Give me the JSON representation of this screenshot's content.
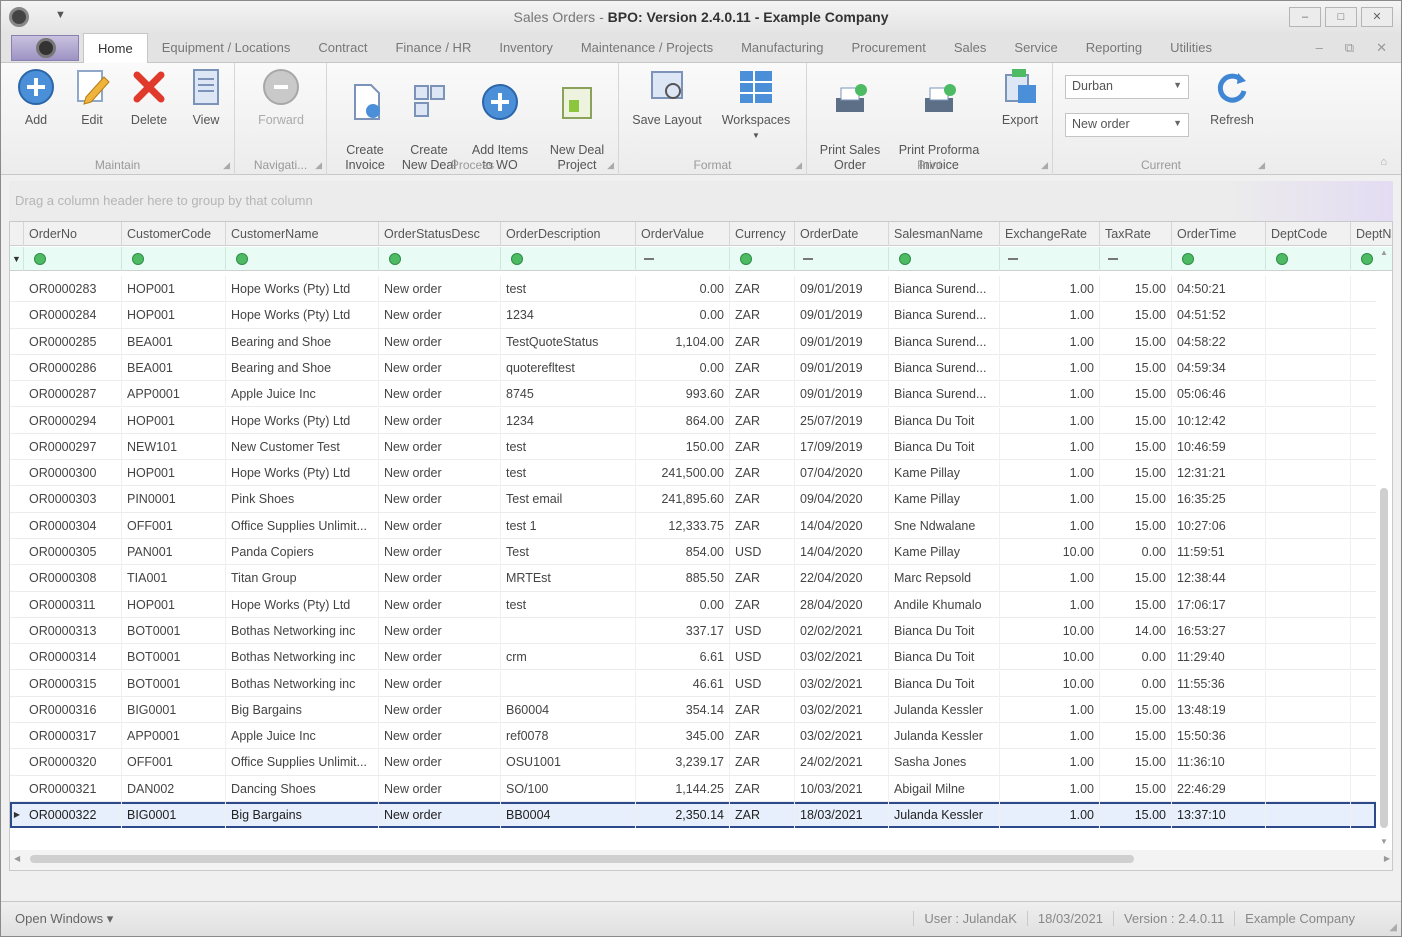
{
  "window": {
    "title_prefix": "Sales Orders - ",
    "title_bold": "BPO: Version 2.4.0.11 - Example Company",
    "controls": [
      "–",
      "□",
      "✕"
    ]
  },
  "tabs": [
    "Home",
    "Equipment / Locations",
    "Contract",
    "Finance / HR",
    "Inventory",
    "Maintenance / Projects",
    "Manufacturing",
    "Procurement",
    "Sales",
    "Service",
    "Reporting",
    "Utilities"
  ],
  "tab_controls": [
    "–",
    "⧉",
    "✕"
  ],
  "ribbon": {
    "maintain": {
      "title": "Maintain",
      "add": "Add",
      "edit": "Edit",
      "delete": "Delete",
      "view": "View"
    },
    "navigate": {
      "title": "Navigati...",
      "forward": "Forward"
    },
    "process": {
      "title": "Process",
      "create_invoice": "Create\nInvoice",
      "create_new_deal": "Create\nNew Deal",
      "add_items_to_wo": "Add Items\nto WO",
      "new_deal_project": "New Deal\nProject"
    },
    "format": {
      "title": "Format",
      "save_layout": "Save Layout",
      "workspaces": "Workspaces"
    },
    "print": {
      "title": "Print",
      "print_sales_order": "Print Sales\nOrder",
      "print_proforma_invoice": "Print Proforma\nInvoice",
      "export": "Export"
    },
    "current": {
      "title": "Current",
      "branch": "Durban",
      "status": "New order",
      "refresh": "Refresh"
    }
  },
  "group_panel_hint": "Drag a column header here to group by that column",
  "grid": {
    "columns": [
      "OrderNo",
      "CustomerCode",
      "CustomerName",
      "OrderStatusDesc",
      "OrderDescription",
      "OrderValue",
      "Currency",
      "OrderDate",
      "SalesmanName",
      "ExchangeRate",
      "TaxRate",
      "OrderTime",
      "DeptCode",
      "DeptNa"
    ],
    "rows": [
      [
        "OR0000283",
        "HOP001",
        "Hope Works (Pty) Ltd",
        "New order",
        "test",
        "0.00",
        "ZAR",
        "09/01/2019",
        "Bianca Surend...",
        "1.00",
        "15.00",
        "04:50:21",
        "",
        ""
      ],
      [
        "OR0000284",
        "HOP001",
        "Hope Works (Pty) Ltd",
        "New order",
        "1234",
        "0.00",
        "ZAR",
        "09/01/2019",
        "Bianca Surend...",
        "1.00",
        "15.00",
        "04:51:52",
        "",
        ""
      ],
      [
        "OR0000285",
        "BEA001",
        "Bearing and Shoe",
        "New order",
        "TestQuoteStatus",
        "1,104.00",
        "ZAR",
        "09/01/2019",
        "Bianca Surend...",
        "1.00",
        "15.00",
        "04:58:22",
        "",
        ""
      ],
      [
        "OR0000286",
        "BEA001",
        "Bearing and Shoe",
        "New order",
        "quoterefltest",
        "0.00",
        "ZAR",
        "09/01/2019",
        "Bianca Surend...",
        "1.00",
        "15.00",
        "04:59:34",
        "",
        ""
      ],
      [
        "OR0000287",
        "APP0001",
        "Apple Juice Inc",
        "New order",
        "8745",
        "993.60",
        "ZAR",
        "09/01/2019",
        "Bianca Surend...",
        "1.00",
        "15.00",
        "05:06:46",
        "",
        ""
      ],
      [
        "OR0000294",
        "HOP001",
        "Hope Works (Pty) Ltd",
        "New order",
        "1234",
        "864.00",
        "ZAR",
        "25/07/2019",
        "Bianca Du Toit",
        "1.00",
        "15.00",
        "10:12:42",
        "",
        ""
      ],
      [
        "OR0000297",
        "NEW101",
        "New Customer Test",
        "New order",
        "test",
        "150.00",
        "ZAR",
        "17/09/2019",
        "Bianca Du Toit",
        "1.00",
        "15.00",
        "10:46:59",
        "",
        ""
      ],
      [
        "OR0000300",
        "HOP001",
        "Hope Works (Pty) Ltd",
        "New order",
        "test",
        "241,500.00",
        "ZAR",
        "07/04/2020",
        "Kame Pillay",
        "1.00",
        "15.00",
        "12:31:21",
        "",
        ""
      ],
      [
        "OR0000303",
        "PIN0001",
        "Pink Shoes",
        "New order",
        "Test email",
        "241,895.60",
        "ZAR",
        "09/04/2020",
        "Kame Pillay",
        "1.00",
        "15.00",
        "16:35:25",
        "",
        ""
      ],
      [
        "OR0000304",
        "OFF001",
        "Office Supplies Unlimit...",
        "New order",
        "test 1",
        "12,333.75",
        "ZAR",
        "14/04/2020",
        "Sne Ndwalane",
        "1.00",
        "15.00",
        "10:27:06",
        "",
        ""
      ],
      [
        "OR0000305",
        "PAN001",
        "Panda Copiers",
        "New order",
        "Test",
        "854.00",
        "USD",
        "14/04/2020",
        "Kame Pillay",
        "10.00",
        "0.00",
        "11:59:51",
        "",
        ""
      ],
      [
        "OR0000308",
        "TIA001",
        "Titan Group",
        "New order",
        "MRTEst",
        "885.50",
        "ZAR",
        "22/04/2020",
        "Marc Repsold",
        "1.00",
        "15.00",
        "12:38:44",
        "",
        ""
      ],
      [
        "OR0000311",
        "HOP001",
        "Hope Works (Pty) Ltd",
        "New order",
        "test",
        "0.00",
        "ZAR",
        "28/04/2020",
        "Andile Khumalo",
        "1.00",
        "15.00",
        "17:06:17",
        "",
        ""
      ],
      [
        "OR0000313",
        "BOT0001",
        "Bothas Networking inc",
        "New order",
        "",
        "337.17",
        "USD",
        "02/02/2021",
        "Bianca Du Toit",
        "10.00",
        "14.00",
        "16:53:27",
        "",
        ""
      ],
      [
        "OR0000314",
        "BOT0001",
        "Bothas Networking inc",
        "New order",
        "crm",
        "6.61",
        "USD",
        "03/02/2021",
        "Bianca Du Toit",
        "10.00",
        "0.00",
        "11:29:40",
        "",
        ""
      ],
      [
        "OR0000315",
        "BOT0001",
        "Bothas Networking inc",
        "New order",
        "",
        "46.61",
        "USD",
        "03/02/2021",
        "Bianca Du Toit",
        "10.00",
        "0.00",
        "11:55:36",
        "",
        ""
      ],
      [
        "OR0000316",
        "BIG0001",
        "Big Bargains",
        "New order",
        "B60004",
        "354.14",
        "ZAR",
        "03/02/2021",
        "Julanda Kessler",
        "1.00",
        "15.00",
        "13:48:19",
        "",
        ""
      ],
      [
        "OR0000317",
        "APP0001",
        "Apple Juice Inc",
        "New order",
        "ref0078",
        "345.00",
        "ZAR",
        "03/02/2021",
        "Julanda Kessler",
        "1.00",
        "15.00",
        "15:50:36",
        "",
        ""
      ],
      [
        "OR0000320",
        "OFF001",
        "Office Supplies Unlimit...",
        "New order",
        "OSU1001",
        "3,239.17",
        "ZAR",
        "24/02/2021",
        "Sasha Jones",
        "1.00",
        "15.00",
        "11:36:10",
        "",
        ""
      ],
      [
        "OR0000321",
        "DAN002",
        "Dancing Shoes",
        "New order",
        "SO/100",
        "1,144.25",
        "ZAR",
        "10/03/2021",
        "Abigail Milne",
        "1.00",
        "15.00",
        "22:46:29",
        "",
        ""
      ],
      [
        "OR0000322",
        "BIG0001",
        "Big Bargains",
        "New order",
        "BB0004",
        "2,350.14",
        "ZAR",
        "18/03/2021",
        "Julanda Kessler",
        "1.00",
        "15.00",
        "13:37:10",
        "",
        ""
      ]
    ]
  },
  "statusbar": {
    "open_windows": "Open Windows ▾",
    "user": "User : JulandaK",
    "date": "18/03/2021",
    "version": "Version : 2.4.0.11",
    "company": "Example Company"
  }
}
